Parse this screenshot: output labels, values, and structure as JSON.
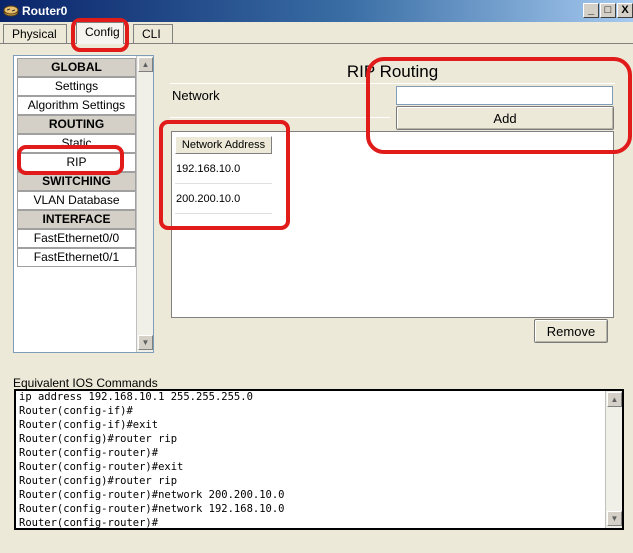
{
  "window": {
    "title": "Router0",
    "buttons": {
      "minimize": "_",
      "maximize": "□",
      "close": "X"
    }
  },
  "tabs": [
    {
      "label": "Physical"
    },
    {
      "label": "Config"
    },
    {
      "label": "CLI"
    }
  ],
  "sidebar": {
    "items": [
      {
        "label": "GLOBAL",
        "header": true
      },
      {
        "label": "Settings"
      },
      {
        "label": "Algorithm Settings"
      },
      {
        "label": "ROUTING",
        "header": true
      },
      {
        "label": "Static"
      },
      {
        "label": "RIP"
      },
      {
        "label": "SWITCHING",
        "header": true
      },
      {
        "label": "VLAN Database"
      },
      {
        "label": "INTERFACE",
        "header": true
      },
      {
        "label": "FastEthernet0/0"
      },
      {
        "label": "FastEthernet0/1"
      }
    ]
  },
  "rip": {
    "title": "RIP Routing",
    "network_label": "Network",
    "network_value": "",
    "add_label": "Add",
    "table": {
      "header": "Network Address",
      "rows": [
        "192.168.10.0",
        "200.200.10.0"
      ]
    },
    "remove_label": "Remove"
  },
  "ios": {
    "label": "Equivalent IOS Commands",
    "lines": [
      "ip address 192.168.10.1 255.255.255.0",
      "Router(config-if)#",
      "Router(config-if)#exit",
      "Router(config)#router rip",
      "Router(config-router)#",
      "Router(config-router)#exit",
      "Router(config)#router rip",
      "Router(config-router)#network 200.200.10.0",
      "Router(config-router)#network 192.168.10.0",
      "Router(config-router)#"
    ]
  },
  "colors": {
    "highlight": "#e11a1a",
    "titlebar": "#0a246a"
  }
}
